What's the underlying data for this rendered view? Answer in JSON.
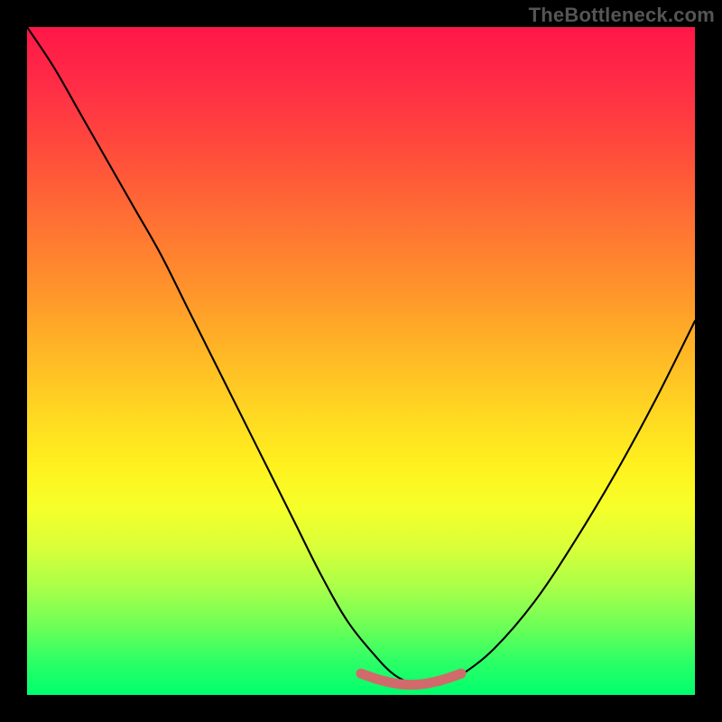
{
  "watermark": "TheBottleneck.com",
  "colors": {
    "background": "#000000",
    "curve": "#000000",
    "marker": "#d16a6a",
    "gradient_top": "#ff1747",
    "gradient_bottom": "#00ff6e"
  },
  "chart_data": {
    "type": "line",
    "title": "",
    "xlabel": "",
    "ylabel": "",
    "xlim": [
      0,
      100
    ],
    "ylim": [
      0,
      100
    ],
    "grid": false,
    "legend": false,
    "series": [
      {
        "name": "bottleneck-curve",
        "x": [
          0,
          4,
          8,
          12,
          16,
          20,
          24,
          28,
          32,
          36,
          40,
          44,
          48,
          52,
          55,
          58,
          60,
          62,
          65,
          70,
          76,
          82,
          88,
          94,
          100
        ],
        "y": [
          100,
          94,
          87,
          80,
          73,
          66,
          58,
          50,
          42,
          34,
          26,
          18,
          11,
          6,
          3,
          1.6,
          1.4,
          1.6,
          3,
          7,
          14,
          23,
          33,
          44,
          56
        ]
      }
    ],
    "annotations": [
      {
        "name": "bottom-marker",
        "x": [
          50,
          53,
          56,
          59,
          62,
          65
        ],
        "y": [
          3.2,
          2.2,
          1.6,
          1.6,
          2.2,
          3.2
        ]
      }
    ],
    "notes": "Values estimated from pixel positions on a 0–100 normalized axis; y=0 is the bottom edge of the gradient area, y=100 is the top. The curve is a V shape with the minimum near x≈60, and a short salmon stroke overlays the trough."
  }
}
